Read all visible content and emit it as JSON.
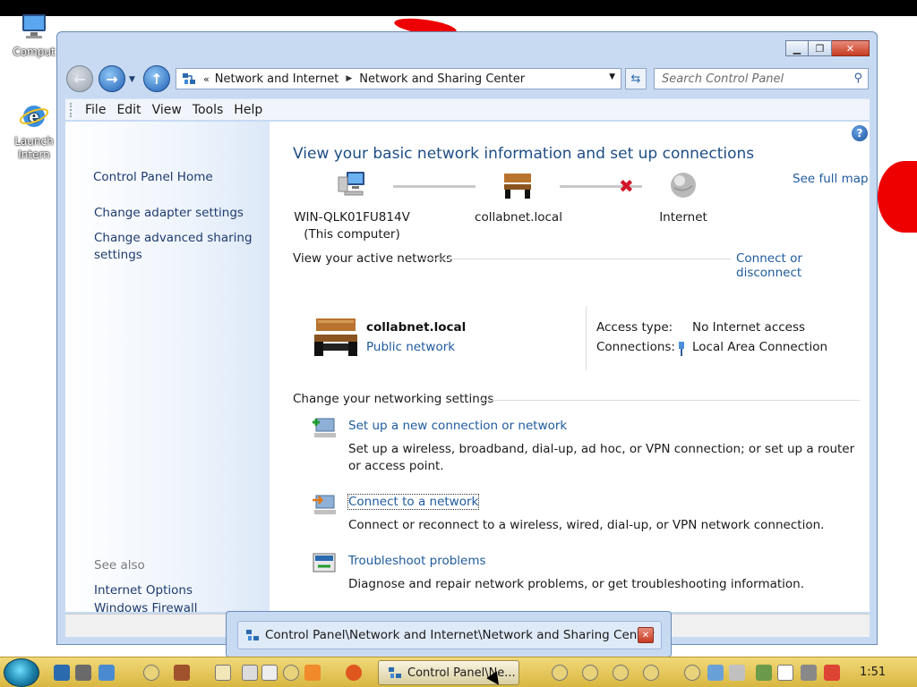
{
  "desktop": {
    "icons": [
      {
        "label": "Comput"
      },
      {
        "label": "Launch\nIntern"
      }
    ]
  },
  "window": {
    "address": {
      "overflow": "«",
      "crumbs": [
        "Network and Internet",
        "Network and Sharing Center"
      ]
    },
    "search_placeholder": "Search Control Panel",
    "menu": [
      "File",
      "Edit",
      "View",
      "Tools",
      "Help"
    ]
  },
  "left_pane": {
    "home": "Control Panel Home",
    "links": [
      "Change adapter settings",
      "Change advanced sharing settings"
    ],
    "see_also_title": "See also",
    "see_also": [
      "Internet Options",
      "Windows Firewall"
    ]
  },
  "main": {
    "heading": "View your basic network information and set up connections",
    "full_map": "See full map",
    "map": {
      "computer_name": "WIN-QLK01FU814V",
      "computer_sub": "(This computer)",
      "network": "collabnet.local",
      "internet": "Internet"
    },
    "active_networks": {
      "title": "View your active networks",
      "connect_link": "Connect or disconnect",
      "network_name": "collabnet.local",
      "network_type": "Public network",
      "access_label": "Access type:",
      "access_value": "No Internet access",
      "connections_label": "Connections:",
      "connections_value": "Local Area Connection"
    },
    "settings": {
      "title": "Change your networking settings",
      "tasks": [
        {
          "title": "Set up a new connection or network",
          "desc": "Set up a wireless, broadband, dial-up, ad hoc, or VPN connection; or set up a router or access point."
        },
        {
          "title": "Connect to a network",
          "desc": "Connect or reconnect to a wireless, wired, dial-up, or VPN network connection."
        },
        {
          "title": "Troubleshoot problems",
          "desc": "Diagnose and repair network problems, or get troubleshooting information."
        }
      ]
    }
  },
  "taskbar": {
    "thumbnail_title": "Control Panel\\Network and Internet\\Network and Sharing Center",
    "active_button": "Control Panel\\Ne...",
    "clock": "1:51"
  },
  "colors": {
    "link": "#1e5a9e",
    "heading": "#1e4d85",
    "disconnected": "#d0182a",
    "taskbar": "#e2c35a"
  }
}
